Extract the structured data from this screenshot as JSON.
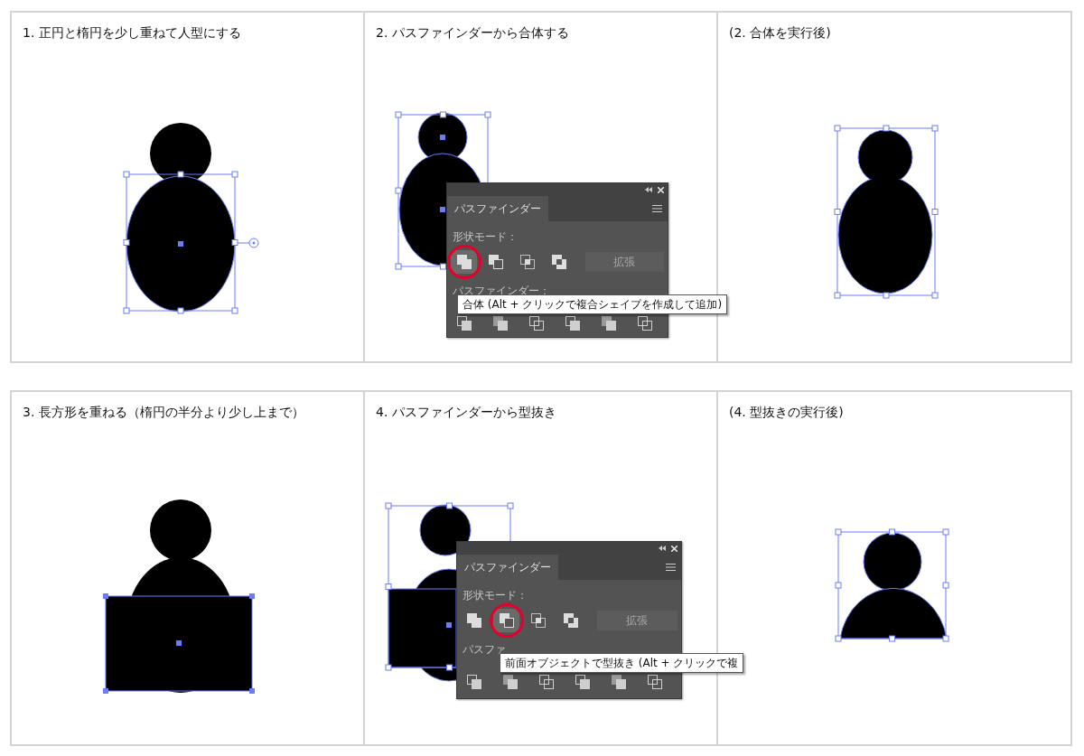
{
  "steps": [
    {
      "caption": "1. 正円と楕円を少し重ねて人型にする",
      "kind": "overlap"
    },
    {
      "caption": "2. パスファインダーから合体する",
      "kind": "unite_panel",
      "panel": {
        "tab": "パスファインダー",
        "shape_modes_label": "形状モード：",
        "shape_modes": [
          {
            "selected": true
          },
          {
            "selected": false
          },
          {
            "selected": false
          },
          {
            "selected": false
          }
        ],
        "expand_button": {
          "label": "拡張",
          "disabled": true
        },
        "pathfinders_label": "パスファインダー：",
        "tooltip": "合体 (Alt + クリックで複合シェイプを作成して追加)"
      }
    },
    {
      "caption": "(2. 合体を実行後)",
      "kind": "united"
    },
    {
      "caption": "3. 長方形を重ねる（楕円の半分より少し上まで）",
      "kind": "rectangle"
    },
    {
      "caption": "4. パスファインダーから型抜き",
      "kind": "minus_panel",
      "panel": {
        "tab": "パスファインダー",
        "shape_modes_label": "形状モード：",
        "shape_modes": [
          {
            "selected": false
          },
          {
            "selected": true
          },
          {
            "selected": false
          },
          {
            "selected": false
          }
        ],
        "expand_button": {
          "label": "拡張",
          "disabled": true
        },
        "pathfinders_label": "パスファ",
        "tooltip": "前面オブジェクトで型抜き (Alt + クリックで複"
      }
    },
    {
      "caption": "(4. 型抜きの実行後)",
      "kind": "result"
    }
  ]
}
